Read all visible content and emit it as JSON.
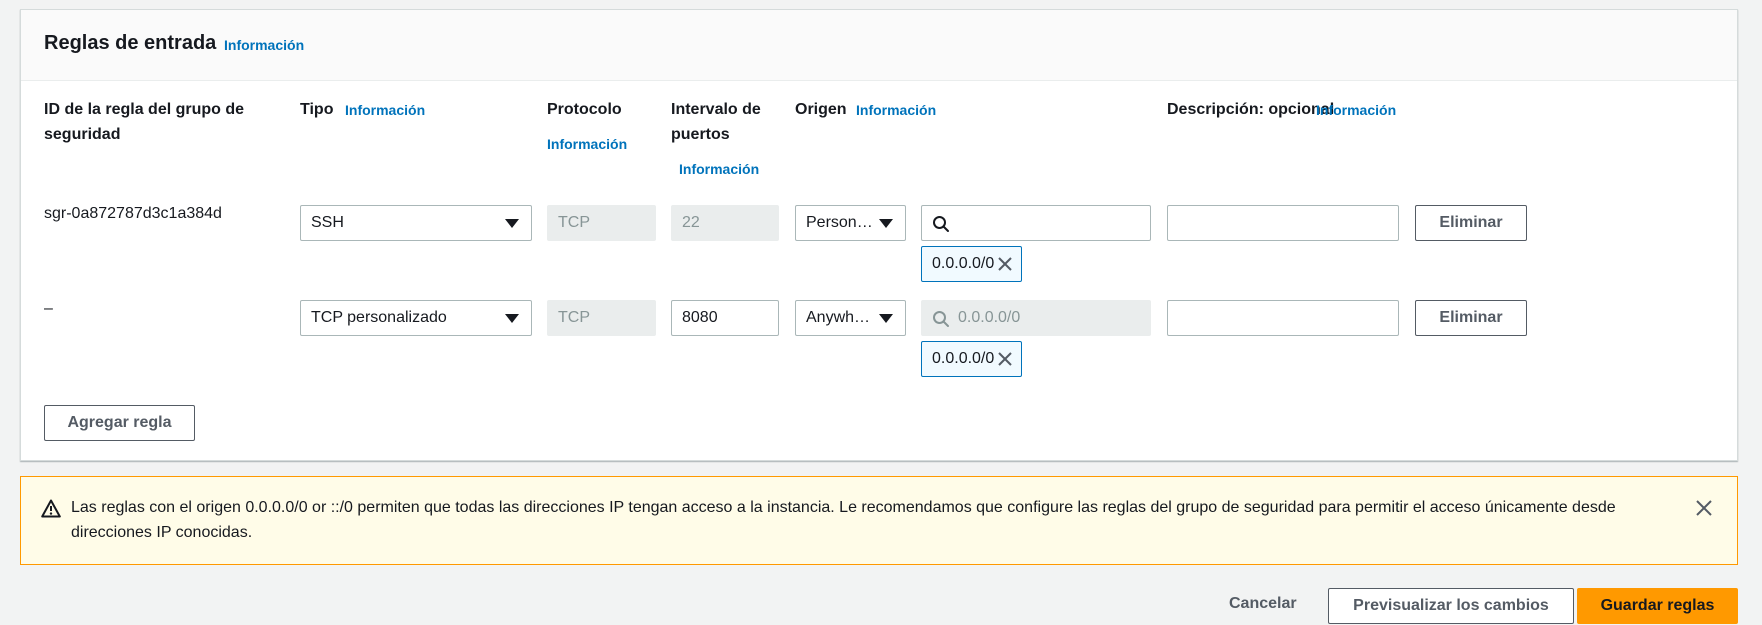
{
  "panel": {
    "title": "Reglas de entrada",
    "info": "Información"
  },
  "columns": {
    "id": "ID de la regla del grupo de seguridad",
    "type": "Tipo",
    "type_info": "Información",
    "protocol": "Protocolo",
    "protocol_info": "Información",
    "port_range": "Intervalo de puertos",
    "port_range_info": "Información",
    "origin": "Origen",
    "origin_info": "Información",
    "description": "Descripción: opcional",
    "description_info": "Información"
  },
  "rules": [
    {
      "id": "sgr-0a872787d3c1a384d",
      "type": "SSH",
      "protocol": "TCP",
      "port": "22",
      "origin": "Persona…",
      "search_value": "",
      "search_placeholder": "",
      "token": "0.0.0.0/0",
      "description": "",
      "delete_label": "Eliminar"
    },
    {
      "id": "–",
      "type": "TCP personalizado",
      "protocol": "TCP",
      "port": "8080",
      "origin": "Anywhe…",
      "search_value": "",
      "search_placeholder": "0.0.0.0/0",
      "token": "0.0.0.0/0",
      "description": "",
      "delete_label": "Eliminar"
    }
  ],
  "add_rule_label": "Agregar regla",
  "alert": {
    "text": "Las reglas con el origen 0.0.0.0/0 or ::/0 permiten que todas las direcciones IP tengan acceso a la instancia. Le recomendamos que configure las reglas del grupo de seguridad para permitir el acceso únicamente desde direcciones IP conocidas."
  },
  "footer": {
    "cancel_label": "Cancelar",
    "preview_label": "Previsualizar los cambios",
    "save_label": "Guardar reglas"
  },
  "colors": {
    "accent_link": "#0073bb",
    "primary_button": "#ff9900",
    "warning_border": "#ff9900",
    "warning_background": "#fffce8"
  },
  "icons": [
    "search-icon",
    "close-icon",
    "warning-icon",
    "caret-down-icon"
  ]
}
